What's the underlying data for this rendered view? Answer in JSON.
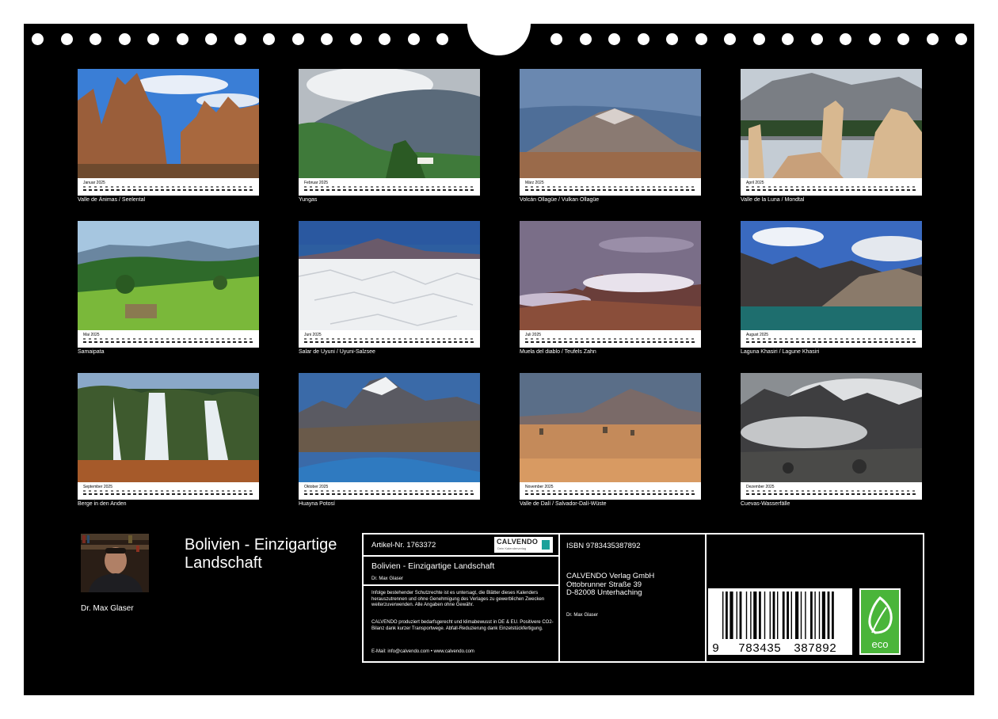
{
  "months": [
    {
      "month": "Januar 2025",
      "caption": "Valle de Ánimas / Seelental"
    },
    {
      "month": "Februar 2025",
      "caption": "Yungas"
    },
    {
      "month": "März 2025",
      "caption": "Volcán Ollagüe / Vulkan Ollagüe"
    },
    {
      "month": "April 2025",
      "caption": "Valle de la Luna / Mondtal"
    },
    {
      "month": "Mai 2025",
      "caption": "Samaipata"
    },
    {
      "month": "Juni 2025",
      "caption": "Salar de Uyuni / Uyuni-Salzsee"
    },
    {
      "month": "Juli 2025",
      "caption": "Muela del diablo / Teufels Zahn"
    },
    {
      "month": "August 2025",
      "caption": "Laguna Khasiri / Lagune Khasiri"
    },
    {
      "month": "September 2025",
      "caption": "Berge in den Anden"
    },
    {
      "month": "Oktober 2025",
      "caption": "Huayna Potosí"
    },
    {
      "month": "November 2025",
      "caption": "Valle de Dalí / Salvador-Dalí-Wüste"
    },
    {
      "month": "Dezember 2025",
      "caption": "Cuevas-Wasserfälle"
    }
  ],
  "cover": {
    "title": "Bolivien - Einzigartige Landschaft",
    "author": "Dr. Max Glaser"
  },
  "product": {
    "article": "Artikel-Nr. 1763372",
    "logo_text": "CALVENDO",
    "logo_sub": "Dein Kalenderverlag",
    "title": "Bolivien - Einzigartige  Landschaft",
    "author": "Dr. Max Glaser",
    "notice1": "Infolge bestehender Schutzrechte ist es untersagt, die Blätter dieses Kalenders herauszutrennen und ohne Genehmigung des Verlages zu gewerblichen Zwecken weiterzuverwenden. Alle Angaben ohne Gewähr.",
    "notice2": "CALVENDO produziert bedarfsgerecht und klimabewusst in DE & EU. Positivere CO2-Bilanz dank kurzer Transportwege. Abfall-Reduzierung dank Einzelstückfertigung.",
    "contact": "E-Mail: info@calvendo.com • www.calvendo.com",
    "isbn": "ISBN 9783435387892",
    "publisher_name": "CALVENDO Verlag GmbH",
    "publisher_street": "Ottobrunner Straße 39",
    "publisher_city": "D-82008 Unterhaching",
    "publisher_author": "Dr. Max Glaser",
    "barcode_digits": [
      "9",
      "783435",
      "387892"
    ],
    "eco_label": "eco"
  }
}
